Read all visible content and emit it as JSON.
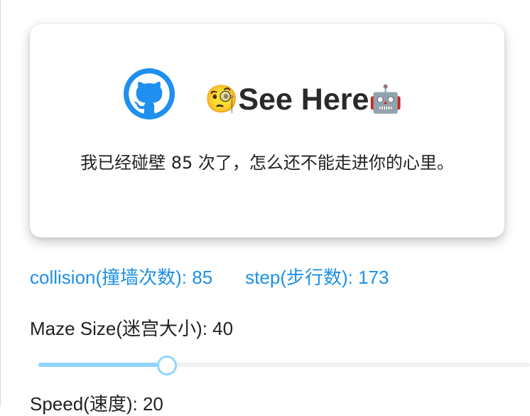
{
  "card": {
    "github_icon": "github-icon",
    "title_prefix_emoji": "🧐",
    "title": "See Here",
    "title_suffix_emoji": "🤖",
    "message": "我已经碰壁 85 次了，怎么还不能走进你的心里。"
  },
  "stats": {
    "collision": "collision(撞墙次数): 85",
    "step": "step(步行数): 173"
  },
  "maze_size": {
    "label": "Maze Size(迷宫大小): 40",
    "slider_fraction": 0.26
  },
  "speed": {
    "label": "Speed(速度): 20"
  },
  "colors": {
    "accent": "#1e90e6",
    "slider_track": "#91d5ff",
    "github_blue": "#1f8ff0"
  }
}
